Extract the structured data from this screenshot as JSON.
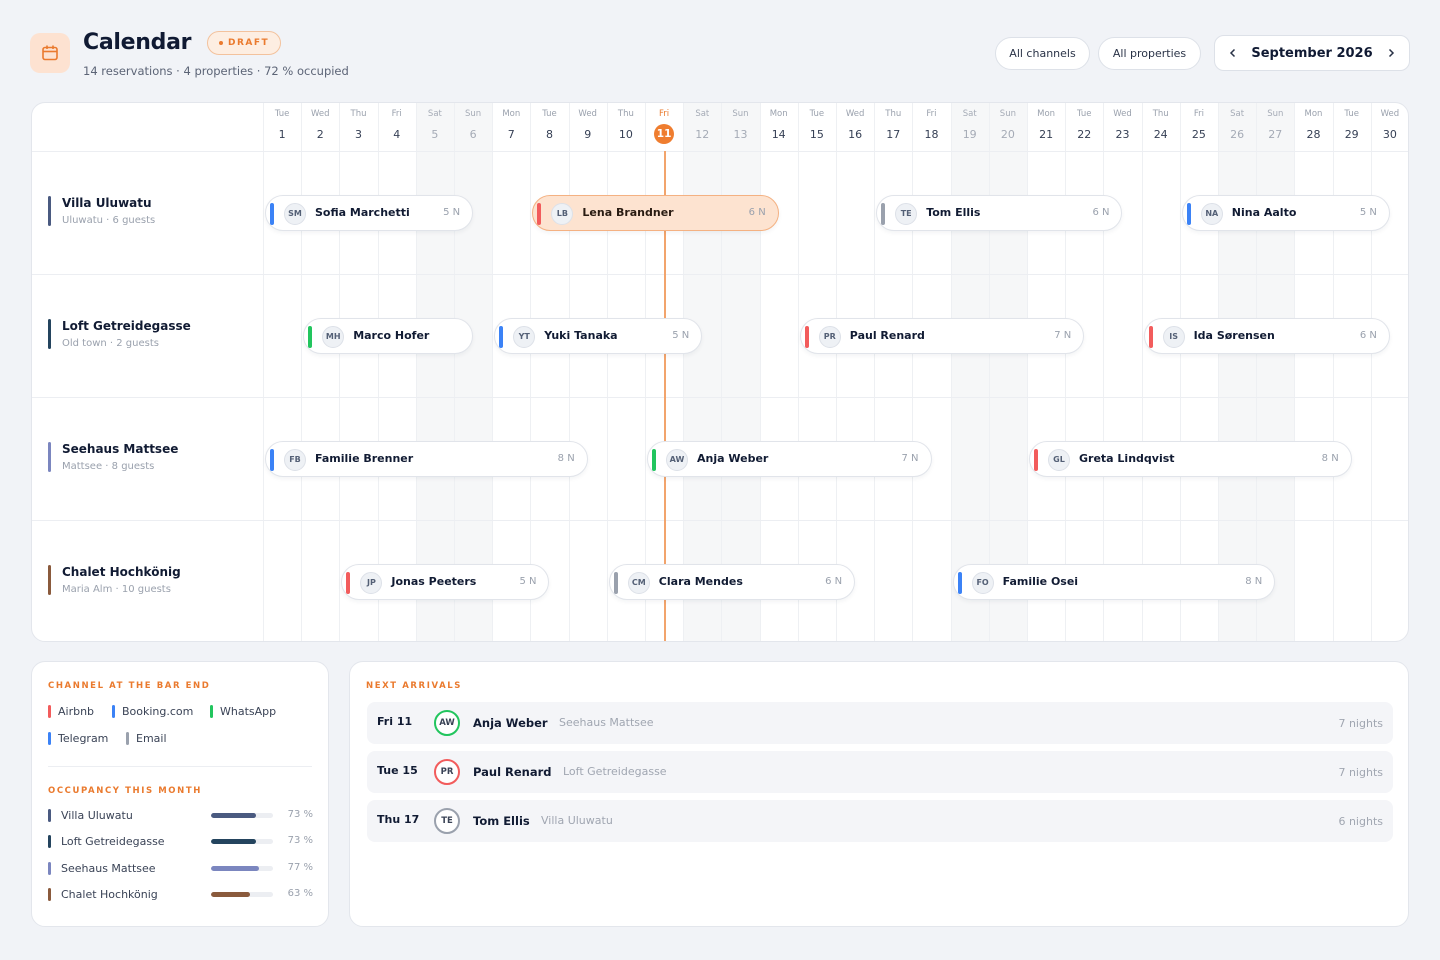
{
  "header": {
    "title": "Calendar",
    "badge": "DRAFT",
    "subtitle": "14 reservations · 4 properties · 72 % occupied",
    "filters": [
      "All channels",
      "All properties"
    ],
    "month": "September 2026"
  },
  "colors": {
    "accent": "#ef7d2f",
    "airbnb": "#f25c5c",
    "booking": "#3b82f6",
    "whatsapp": "#22c55e",
    "telegram": "#3b82f6",
    "email": "#9aa1ad"
  },
  "days": [
    {
      "dow": "Tue",
      "num": "1"
    },
    {
      "dow": "Wed",
      "num": "2"
    },
    {
      "dow": "Thu",
      "num": "3"
    },
    {
      "dow": "Fri",
      "num": "4"
    },
    {
      "dow": "Sat",
      "num": "5"
    },
    {
      "dow": "Sun",
      "num": "6"
    },
    {
      "dow": "Mon",
      "num": "7"
    },
    {
      "dow": "Tue",
      "num": "8"
    },
    {
      "dow": "Wed",
      "num": "9"
    },
    {
      "dow": "Thu",
      "num": "10"
    },
    {
      "dow": "Fri",
      "num": "11"
    },
    {
      "dow": "Sat",
      "num": "12"
    },
    {
      "dow": "Sun",
      "num": "13"
    },
    {
      "dow": "Mon",
      "num": "14"
    },
    {
      "dow": "Tue",
      "num": "15"
    },
    {
      "dow": "Wed",
      "num": "16"
    },
    {
      "dow": "Thu",
      "num": "17"
    },
    {
      "dow": "Fri",
      "num": "18"
    },
    {
      "dow": "Sat",
      "num": "19"
    },
    {
      "dow": "Sun",
      "num": "20"
    },
    {
      "dow": "Mon",
      "num": "21"
    },
    {
      "dow": "Tue",
      "num": "22"
    },
    {
      "dow": "Wed",
      "num": "23"
    },
    {
      "dow": "Thu",
      "num": "24"
    },
    {
      "dow": "Fri",
      "num": "25"
    },
    {
      "dow": "Sat",
      "num": "26"
    },
    {
      "dow": "Sun",
      "num": "27"
    },
    {
      "dow": "Mon",
      "num": "28"
    },
    {
      "dow": "Tue",
      "num": "29"
    },
    {
      "dow": "Wed",
      "num": "30"
    }
  ],
  "today": 11,
  "properties": [
    {
      "name": "Villa Uluwatu",
      "meta": "Uluwatu · 6 guests",
      "color": "#4a5a80",
      "bookings": [
        {
          "initials": "SM",
          "guest": "Sofia Marchetti",
          "nights": "5 N",
          "channel": "booking",
          "start": 1,
          "end": 6
        },
        {
          "initials": "LB",
          "guest": "Lena Brandner",
          "nights": "6 N",
          "channel": "airbnb",
          "start": 8,
          "end": 14,
          "selected": true
        },
        {
          "initials": "TE",
          "guest": "Tom Ellis",
          "nights": "6 N",
          "channel": "email",
          "start": 17,
          "end": 23
        },
        {
          "initials": "NA",
          "guest": "Nina Aalto",
          "nights": "5 N",
          "channel": "booking",
          "start": 25,
          "end": 30
        }
      ]
    },
    {
      "name": "Loft Getreidegasse",
      "meta": "Old town · 2 guests",
      "color": "#24445e",
      "bookings": [
        {
          "initials": "MH",
          "guest": "Marco Hofer",
          "nights": "",
          "channel": "whatsapp",
          "start": 2,
          "end": 6
        },
        {
          "initials": "YT",
          "guest": "Yuki Tanaka",
          "nights": "5 N",
          "channel": "booking",
          "start": 7,
          "end": 12
        },
        {
          "initials": "PR",
          "guest": "Paul Renard",
          "nights": "7 N",
          "channel": "airbnb",
          "start": 15,
          "end": 22
        },
        {
          "initials": "IS",
          "guest": "Ida Sørensen",
          "nights": "6 N",
          "channel": "airbnb",
          "start": 24,
          "end": 30
        }
      ]
    },
    {
      "name": "Seehaus Mattsee",
      "meta": "Mattsee · 8 guests",
      "color": "#7b86bf",
      "bookings": [
        {
          "initials": "FB",
          "guest": "Familie Brenner",
          "nights": "8 N",
          "channel": "booking",
          "start": 1,
          "end": 9
        },
        {
          "initials": "AW",
          "guest": "Anja Weber",
          "nights": "7 N",
          "channel": "whatsapp",
          "start": 11,
          "end": 18
        },
        {
          "initials": "GL",
          "guest": "Greta Lindqvist",
          "nights": "8 N",
          "channel": "airbnb",
          "start": 21,
          "end": 29
        }
      ]
    },
    {
      "name": "Chalet Hochkönig",
      "meta": "Maria Alm · 10 guests",
      "color": "#8a5a3c",
      "bookings": [
        {
          "initials": "JP",
          "guest": "Jonas Peeters",
          "nights": "5 N",
          "channel": "airbnb",
          "start": 3,
          "end": 8
        },
        {
          "initials": "CM",
          "guest": "Clara Mendes",
          "nights": "6 N",
          "channel": "email",
          "start": 10,
          "end": 16
        },
        {
          "initials": "FO",
          "guest": "Familie Osei",
          "nights": "8 N",
          "channel": "booking",
          "start": 19,
          "end": 27
        }
      ]
    }
  ],
  "legend": {
    "title": "CHANNEL AT THE BAR END",
    "channels": [
      {
        "key": "airbnb",
        "label": "Airbnb"
      },
      {
        "key": "booking",
        "label": "Booking.com"
      },
      {
        "key": "whatsapp",
        "label": "WhatsApp"
      },
      {
        "key": "telegram",
        "label": "Telegram"
      },
      {
        "key": "email",
        "label": "Email"
      }
    ]
  },
  "occupancy": {
    "title": "OCCUPANCY THIS MONTH",
    "rows": [
      {
        "name": "Villa Uluwatu",
        "pct": "73 %",
        "value": 73,
        "color": "#4a5a80"
      },
      {
        "name": "Loft Getreidegasse",
        "pct": "73 %",
        "value": 73,
        "color": "#24445e"
      },
      {
        "name": "Seehaus Mattsee",
        "pct": "77 %",
        "value": 77,
        "color": "#7b86bf"
      },
      {
        "name": "Chalet Hochkönig",
        "pct": "63 %",
        "value": 63,
        "color": "#8a5a3c"
      }
    ]
  },
  "arrivals": {
    "title": "NEXT ARRIVALS",
    "rows": [
      {
        "day": "Fri 11",
        "initials": "AW",
        "guest": "Anja Weber",
        "property": "Seehaus Mattsee",
        "nights": "7 nights",
        "channel": "whatsapp"
      },
      {
        "day": "Tue 15",
        "initials": "PR",
        "guest": "Paul Renard",
        "property": "Loft Getreidegasse",
        "nights": "7 nights",
        "channel": "airbnb"
      },
      {
        "day": "Thu 17",
        "initials": "TE",
        "guest": "Tom Ellis",
        "property": "Villa Uluwatu",
        "nights": "6 nights",
        "channel": "email"
      }
    ]
  }
}
